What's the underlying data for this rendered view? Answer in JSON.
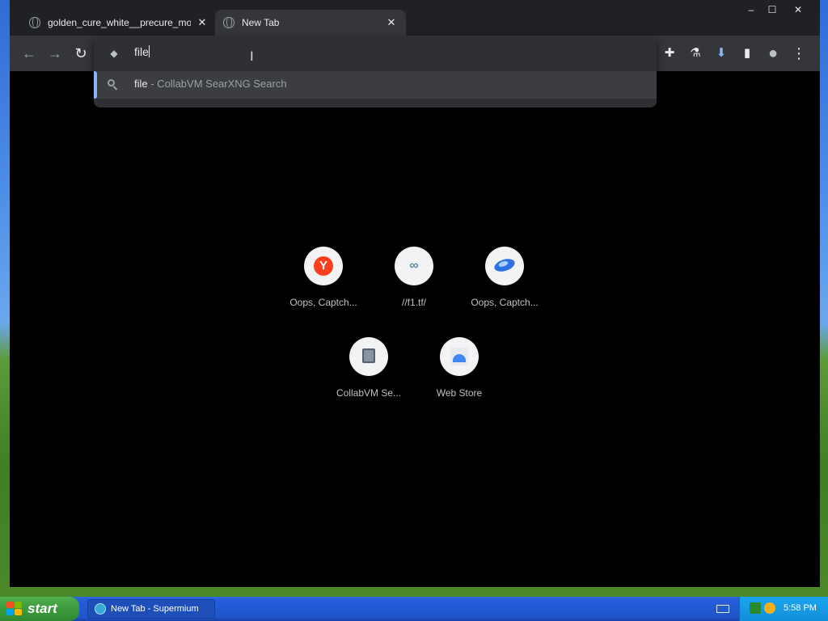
{
  "browser": {
    "tabs": [
      {
        "title": "golden_cure_white__precure_movie",
        "close": "✕"
      },
      {
        "title": "New Tab",
        "close": "✕"
      }
    ],
    "window_controls": {
      "minimize": "–",
      "maximize": "☐",
      "close": "✕"
    },
    "toolbar": {
      "back_icon": "←",
      "forward_icon": "→",
      "reload_icon": "↻",
      "extensions_icon": "✚",
      "labs_icon": "⚗",
      "download_icon": "⬇",
      "sidepanel_icon": "▮",
      "profile_icon": "●",
      "menu_icon": "⋮"
    },
    "omnibox": {
      "text": "file",
      "suggestion": {
        "query": "file",
        "rest": " - CollabVM SearXNG Search"
      }
    },
    "shortcuts": [
      {
        "label": "Oops, Captch...",
        "icon": "yandex-icon"
      },
      {
        "label": "//f1.tf/",
        "icon": "link-icon"
      },
      {
        "label": "Oops, Captch...",
        "icon": "saucer-icon"
      },
      {
        "label": "CollabVM Se...",
        "icon": "collabvm-icon"
      },
      {
        "label": "Web Store",
        "icon": "webstore-icon"
      }
    ]
  },
  "taskbar": {
    "start_label": "start",
    "task_item": "New Tab - Supermium",
    "clock": "5:58 PM"
  },
  "colors": {
    "accent": "#8ab4f8",
    "background": "#000000",
    "toolbar": "#35363a"
  }
}
